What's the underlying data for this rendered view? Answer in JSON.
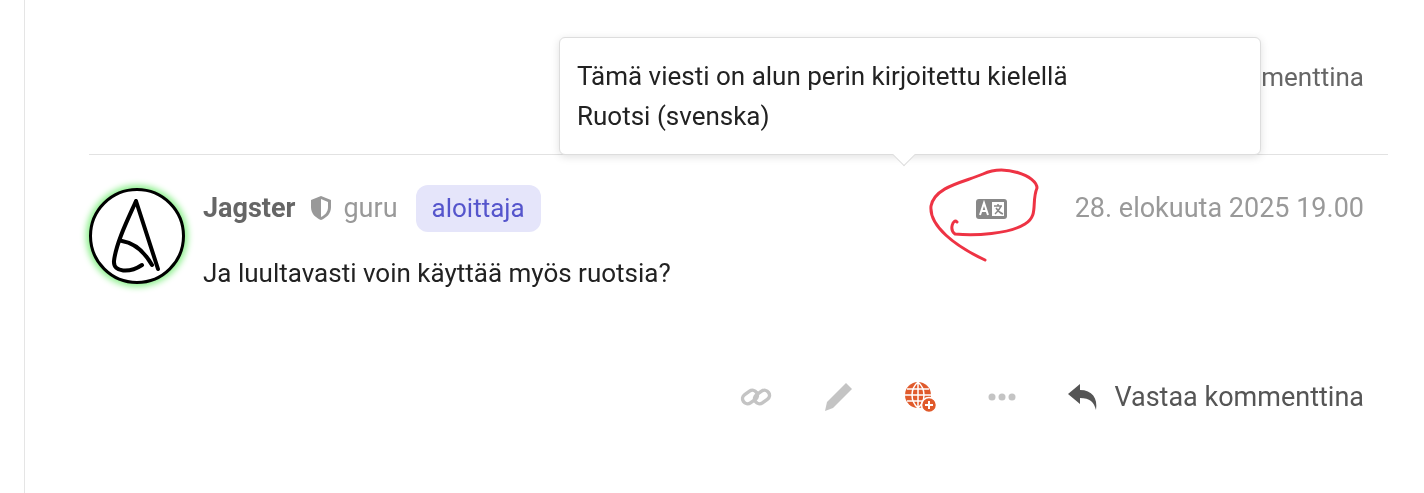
{
  "previous_comment": {
    "reply_text_cut": "menttina"
  },
  "tooltip": {
    "lines": [
      "Tämä viesti on alun perin kirjoitettu kielellä",
      "Ruotsi (svenska)"
    ]
  },
  "comment": {
    "author": "Jagster",
    "role": "guru",
    "badge": "aloittaja",
    "date": "28. elokuuta 2025 19.00",
    "online": true,
    "body": "Ja luultavasti voin käyttää myös ruotsia?"
  },
  "actions": {
    "reply": "Vastaa kommenttina"
  }
}
